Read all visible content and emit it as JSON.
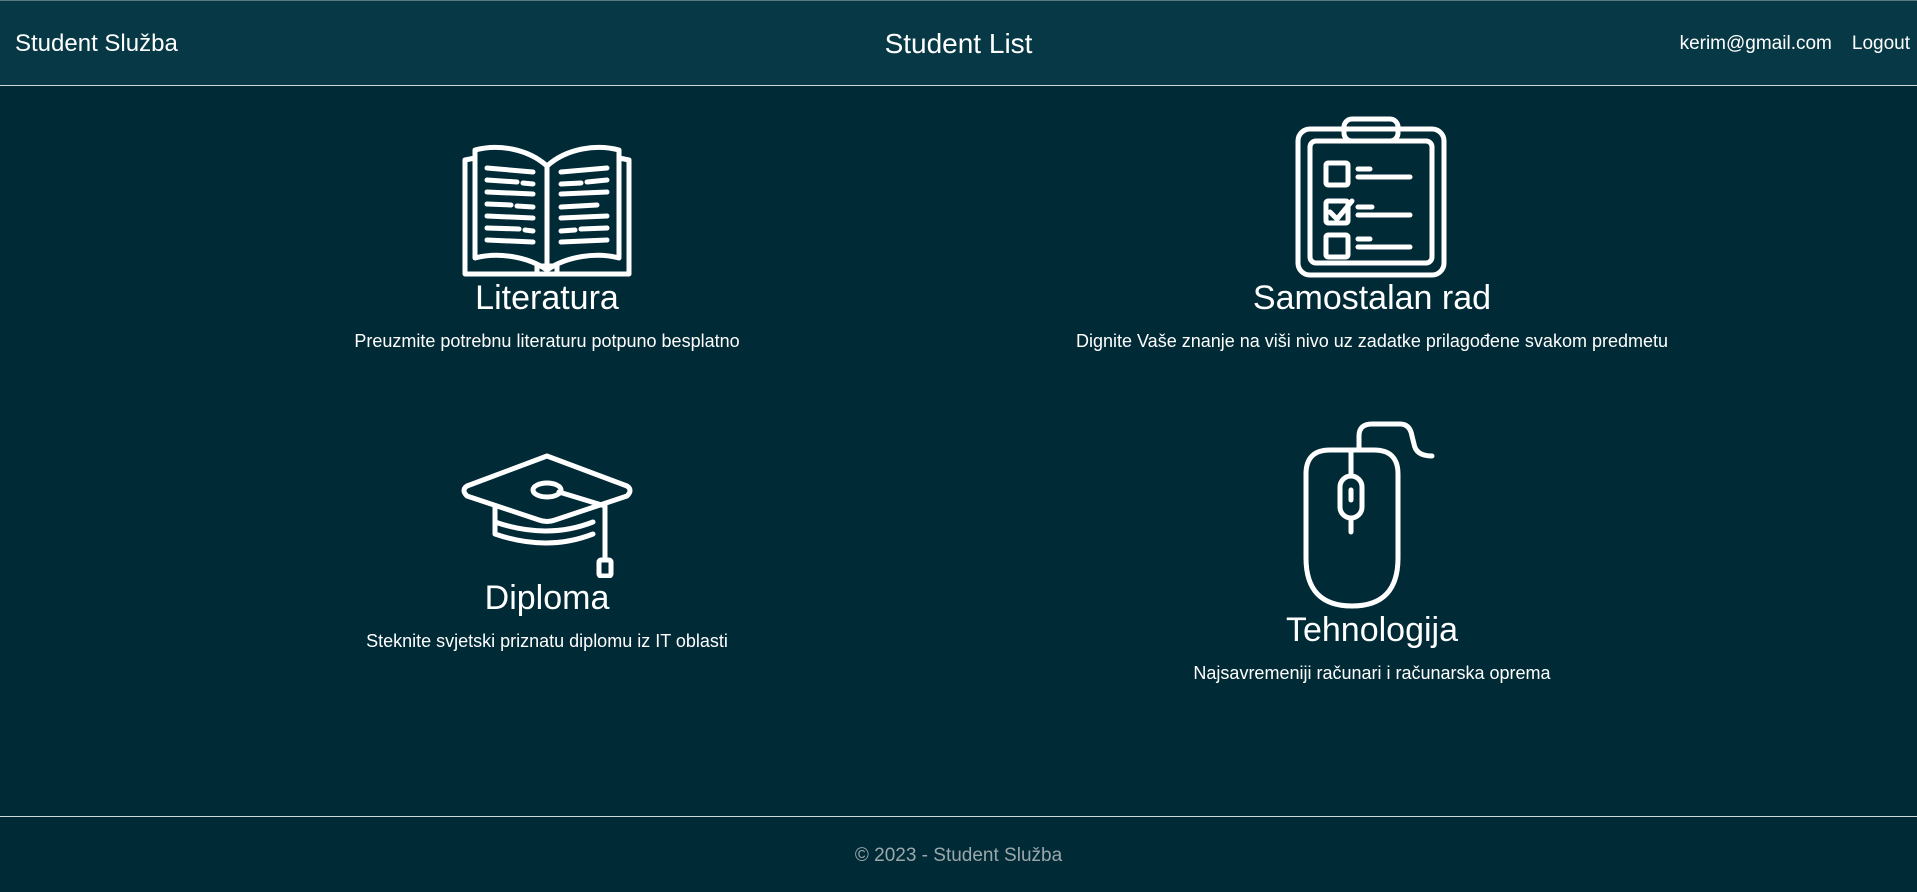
{
  "navbar": {
    "brand": "Student Služba",
    "title": "Student List",
    "user_email": "kerim@gmail.com",
    "logout_label": "Logout"
  },
  "features": [
    {
      "icon": "open-book-icon",
      "title": "Literatura",
      "description": "Preuzmite potrebnu literaturu potpuno besplatno"
    },
    {
      "icon": "clipboard-checklist-icon",
      "title": "Samostalan rad",
      "description": "Dignite Vaše znanje na viši nivo uz zadatke prilagođene svakom predmetu"
    },
    {
      "icon": "graduation-cap-icon",
      "title": "Diploma",
      "description": "Steknite svjetski priznatu diplomu iz IT oblasti"
    },
    {
      "icon": "computer-mouse-icon",
      "title": "Tehnologija",
      "description": "Najsavremeniji računari i računarska oprema"
    }
  ],
  "footer": {
    "text": "© 2023 - Student Služba"
  }
}
